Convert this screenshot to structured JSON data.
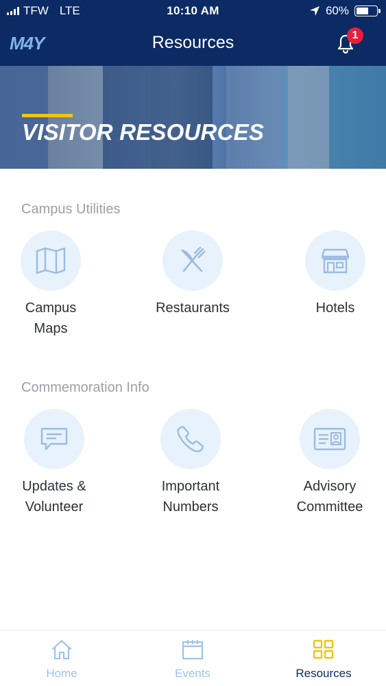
{
  "status_bar": {
    "carrier": "TFW",
    "network": "LTE",
    "time": "10:10 AM",
    "battery": "60%",
    "battery_level": 0.6
  },
  "nav": {
    "logo": "M4Y",
    "title": "Resources",
    "notification_count": "1",
    "badge_color": "#e3203d"
  },
  "hero": {
    "title": "VISITOR RESOURCES",
    "accent_color": "#f1c40f"
  },
  "sections": [
    {
      "title": "Campus Utilities",
      "items": [
        {
          "icon": "map-icon",
          "label_line1": "Campus",
          "label_line2": "Maps"
        },
        {
          "icon": "fork-knife-icon",
          "label_line1": "Restaurants",
          "label_line2": ""
        },
        {
          "icon": "store-icon",
          "label_line1": "Hotels",
          "label_line2": ""
        }
      ]
    },
    {
      "title": "Commemoration Info",
      "items": [
        {
          "icon": "message-icon",
          "label_line1": "Updates &",
          "label_line2": "Volunteer"
        },
        {
          "icon": "phone-icon",
          "label_line1": "Important",
          "label_line2": "Numbers"
        },
        {
          "icon": "id-card-icon",
          "label_line1": "Advisory",
          "label_line2": "Committee"
        }
      ]
    }
  ],
  "tabbar": {
    "tabs": [
      {
        "label": "Home",
        "icon": "home-icon",
        "active": false
      },
      {
        "label": "Events",
        "icon": "calendar-icon",
        "active": false
      },
      {
        "label": "Resources",
        "icon": "grid-icon",
        "active": true
      }
    ],
    "active_color": "#f1c40f",
    "inactive_color": "#9cc3ea"
  },
  "colors": {
    "primary_dark": "#0c2a63",
    "icon_circle": "#e8f2fc",
    "icon_stroke": "#9bbbe0"
  }
}
